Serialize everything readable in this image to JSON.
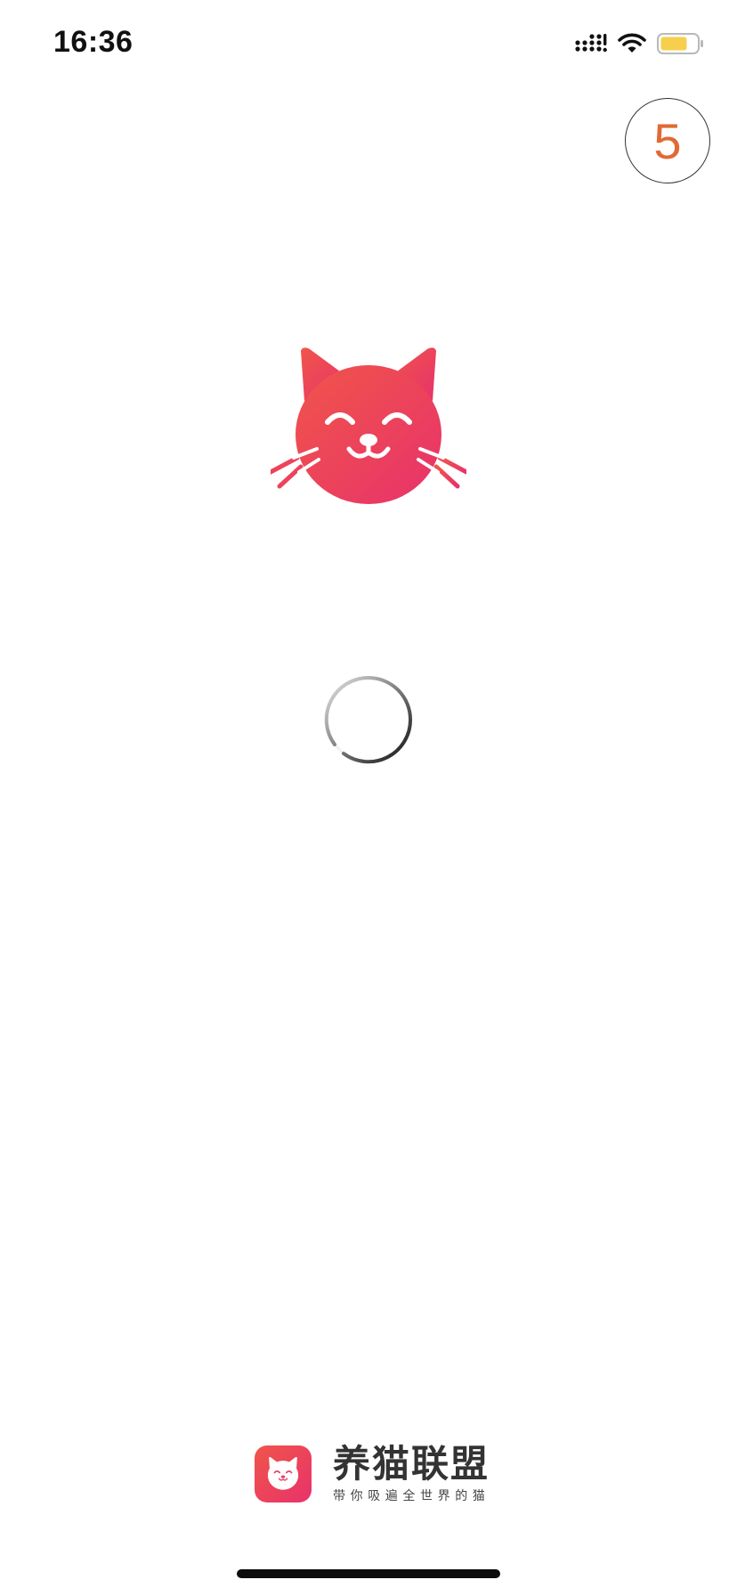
{
  "status_bar": {
    "time": "16:36",
    "icons": [
      "cellular-signal-icon",
      "wifi-icon",
      "battery-icon"
    ],
    "battery_color": "#f6cf4e"
  },
  "splash": {
    "countdown": "5",
    "countdown_color": "#e06a36",
    "logo_icon": "cat-face-icon",
    "loading_icon": "loading-spinner-icon",
    "logo_gradient": [
      "#f0554a",
      "#e8326b"
    ]
  },
  "brand": {
    "name": "养猫联盟",
    "slogan": "带你吸遍全世界的猫"
  }
}
